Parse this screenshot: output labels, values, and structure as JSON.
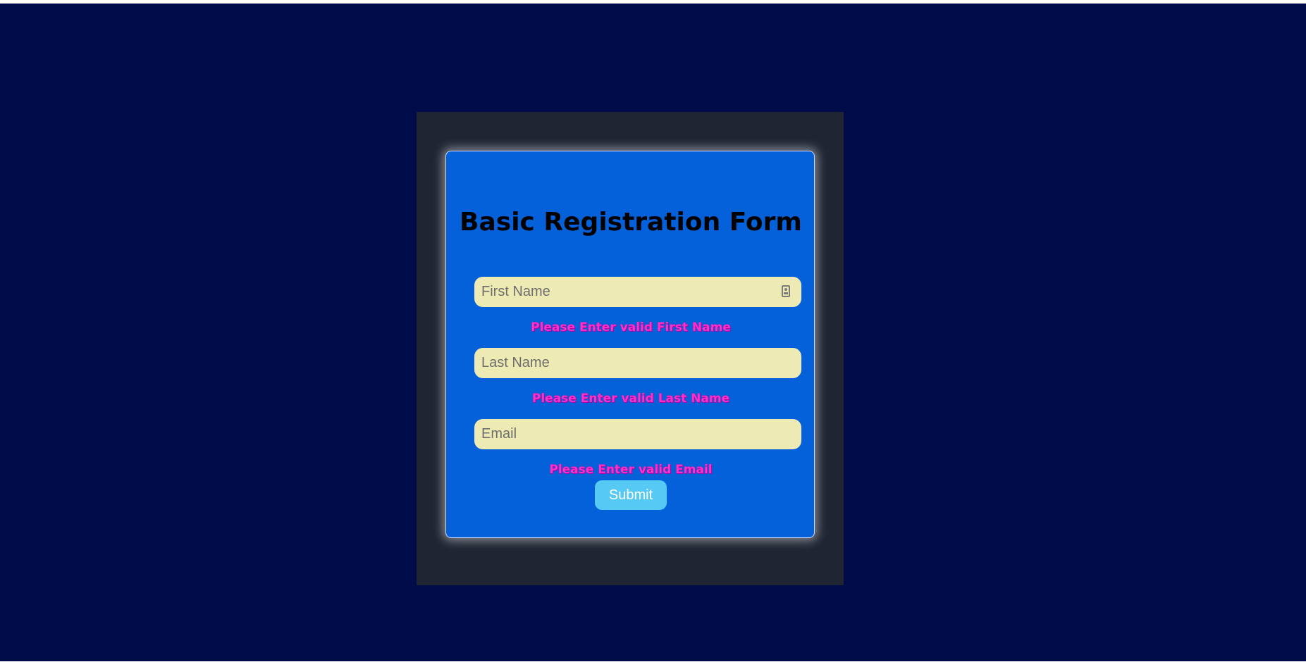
{
  "form": {
    "title": "Basic Registration Form",
    "fields": {
      "first_name": {
        "placeholder": "First Name",
        "value": "",
        "error": "Please Enter valid First Name",
        "icon": "contact-card-icon"
      },
      "last_name": {
        "placeholder": "Last Name",
        "value": "",
        "error": "Please Enter valid Last Name"
      },
      "email": {
        "placeholder": "Email",
        "value": "",
        "error": "Please Enter valid Email"
      }
    },
    "submit_label": "Submit"
  },
  "colors": {
    "page_background": "#000c4a",
    "frame_background": "#1f2533",
    "card_background": "#0561d9",
    "field_background": "#eeeab4",
    "error_text": "#ff2fc8",
    "submit_background": "#56c9f4"
  }
}
